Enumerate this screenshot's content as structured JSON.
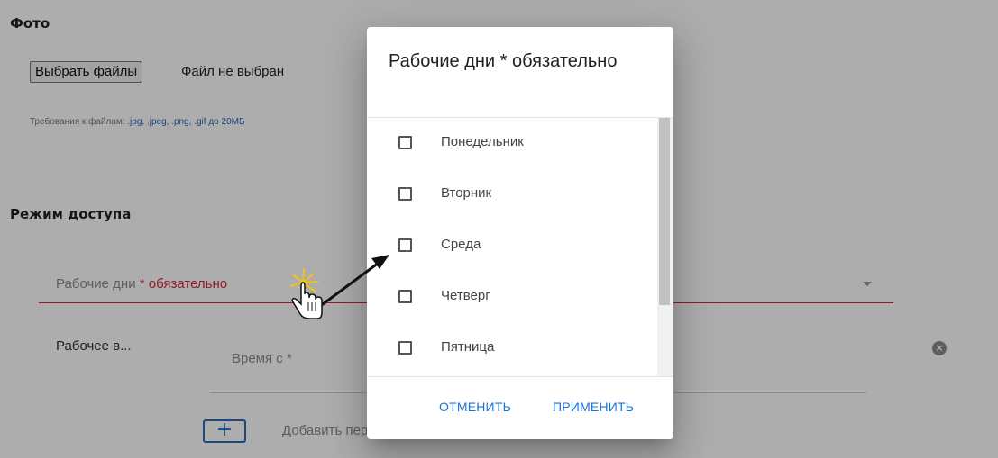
{
  "photo": {
    "title": "Фото",
    "choose_files_label": "Выбрать файлы",
    "file_status": "Файл не выбран",
    "requirements_prefix": "Требования к файлам: ",
    "requirements_types": ".jpg, .jpeg, .png, .gif до 20МБ"
  },
  "access": {
    "title": "Режим доступа",
    "workdays_field": {
      "label": "Рабочие дни ",
      "required_star": "*",
      "required_text": " обязательно"
    },
    "worktime_label": "Рабочее в...",
    "time_from_label": "Время с *",
    "add_label": "Добавить период",
    "add_icon": "plus-icon",
    "clear_icon": "clear-icon"
  },
  "dialog": {
    "title": "Рабочие дни * обязательно",
    "days": [
      {
        "label": "Понедельник",
        "checked": false
      },
      {
        "label": "Вторник",
        "checked": false
      },
      {
        "label": "Среда",
        "checked": false
      },
      {
        "label": "Четверг",
        "checked": false
      },
      {
        "label": "Пятница",
        "checked": false
      }
    ],
    "cancel_label": "ОТМЕНИТЬ",
    "apply_label": "ПРИМЕНИТЬ"
  },
  "colors": {
    "accent": "#1b73d4",
    "error": "#d6293c",
    "overlay": "rgba(0,0,0,0.32)"
  }
}
